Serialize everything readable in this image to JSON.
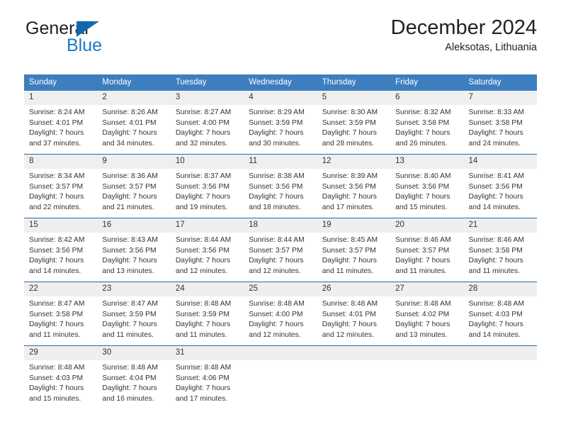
{
  "brand": {
    "name_top": "General",
    "name_bottom": "Blue",
    "triangle_icon": "blue-triangle-icon",
    "color_dark": "#231f20",
    "color_blue": "#1b79c4"
  },
  "header": {
    "title": "December 2024",
    "subtitle": "Aleksotas, Lithuania"
  },
  "colors": {
    "header_row_bg": "#3d7ebf",
    "daynum_bg": "#efefef",
    "week_separator": "#1b6cb0",
    "text": "#333333"
  },
  "weekday_headers": [
    "Sunday",
    "Monday",
    "Tuesday",
    "Wednesday",
    "Thursday",
    "Friday",
    "Saturday"
  ],
  "weeks": [
    [
      {
        "day": "1",
        "sunrise": "Sunrise: 8:24 AM",
        "sunset": "Sunset: 4:01 PM",
        "daylight_line1": "Daylight: 7 hours",
        "daylight_line2": "and 37 minutes."
      },
      {
        "day": "2",
        "sunrise": "Sunrise: 8:26 AM",
        "sunset": "Sunset: 4:01 PM",
        "daylight_line1": "Daylight: 7 hours",
        "daylight_line2": "and 34 minutes."
      },
      {
        "day": "3",
        "sunrise": "Sunrise: 8:27 AM",
        "sunset": "Sunset: 4:00 PM",
        "daylight_line1": "Daylight: 7 hours",
        "daylight_line2": "and 32 minutes."
      },
      {
        "day": "4",
        "sunrise": "Sunrise: 8:29 AM",
        "sunset": "Sunset: 3:59 PM",
        "daylight_line1": "Daylight: 7 hours",
        "daylight_line2": "and 30 minutes."
      },
      {
        "day": "5",
        "sunrise": "Sunrise: 8:30 AM",
        "sunset": "Sunset: 3:59 PM",
        "daylight_line1": "Daylight: 7 hours",
        "daylight_line2": "and 28 minutes."
      },
      {
        "day": "6",
        "sunrise": "Sunrise: 8:32 AM",
        "sunset": "Sunset: 3:58 PM",
        "daylight_line1": "Daylight: 7 hours",
        "daylight_line2": "and 26 minutes."
      },
      {
        "day": "7",
        "sunrise": "Sunrise: 8:33 AM",
        "sunset": "Sunset: 3:58 PM",
        "daylight_line1": "Daylight: 7 hours",
        "daylight_line2": "and 24 minutes."
      }
    ],
    [
      {
        "day": "8",
        "sunrise": "Sunrise: 8:34 AM",
        "sunset": "Sunset: 3:57 PM",
        "daylight_line1": "Daylight: 7 hours",
        "daylight_line2": "and 22 minutes."
      },
      {
        "day": "9",
        "sunrise": "Sunrise: 8:36 AM",
        "sunset": "Sunset: 3:57 PM",
        "daylight_line1": "Daylight: 7 hours",
        "daylight_line2": "and 21 minutes."
      },
      {
        "day": "10",
        "sunrise": "Sunrise: 8:37 AM",
        "sunset": "Sunset: 3:56 PM",
        "daylight_line1": "Daylight: 7 hours",
        "daylight_line2": "and 19 minutes."
      },
      {
        "day": "11",
        "sunrise": "Sunrise: 8:38 AM",
        "sunset": "Sunset: 3:56 PM",
        "daylight_line1": "Daylight: 7 hours",
        "daylight_line2": "and 18 minutes."
      },
      {
        "day": "12",
        "sunrise": "Sunrise: 8:39 AM",
        "sunset": "Sunset: 3:56 PM",
        "daylight_line1": "Daylight: 7 hours",
        "daylight_line2": "and 17 minutes."
      },
      {
        "day": "13",
        "sunrise": "Sunrise: 8:40 AM",
        "sunset": "Sunset: 3:56 PM",
        "daylight_line1": "Daylight: 7 hours",
        "daylight_line2": "and 15 minutes."
      },
      {
        "day": "14",
        "sunrise": "Sunrise: 8:41 AM",
        "sunset": "Sunset: 3:56 PM",
        "daylight_line1": "Daylight: 7 hours",
        "daylight_line2": "and 14 minutes."
      }
    ],
    [
      {
        "day": "15",
        "sunrise": "Sunrise: 8:42 AM",
        "sunset": "Sunset: 3:56 PM",
        "daylight_line1": "Daylight: 7 hours",
        "daylight_line2": "and 14 minutes."
      },
      {
        "day": "16",
        "sunrise": "Sunrise: 8:43 AM",
        "sunset": "Sunset: 3:56 PM",
        "daylight_line1": "Daylight: 7 hours",
        "daylight_line2": "and 13 minutes."
      },
      {
        "day": "17",
        "sunrise": "Sunrise: 8:44 AM",
        "sunset": "Sunset: 3:56 PM",
        "daylight_line1": "Daylight: 7 hours",
        "daylight_line2": "and 12 minutes."
      },
      {
        "day": "18",
        "sunrise": "Sunrise: 8:44 AM",
        "sunset": "Sunset: 3:57 PM",
        "daylight_line1": "Daylight: 7 hours",
        "daylight_line2": "and 12 minutes."
      },
      {
        "day": "19",
        "sunrise": "Sunrise: 8:45 AM",
        "sunset": "Sunset: 3:57 PM",
        "daylight_line1": "Daylight: 7 hours",
        "daylight_line2": "and 11 minutes."
      },
      {
        "day": "20",
        "sunrise": "Sunrise: 8:46 AM",
        "sunset": "Sunset: 3:57 PM",
        "daylight_line1": "Daylight: 7 hours",
        "daylight_line2": "and 11 minutes."
      },
      {
        "day": "21",
        "sunrise": "Sunrise: 8:46 AM",
        "sunset": "Sunset: 3:58 PM",
        "daylight_line1": "Daylight: 7 hours",
        "daylight_line2": "and 11 minutes."
      }
    ],
    [
      {
        "day": "22",
        "sunrise": "Sunrise: 8:47 AM",
        "sunset": "Sunset: 3:58 PM",
        "daylight_line1": "Daylight: 7 hours",
        "daylight_line2": "and 11 minutes."
      },
      {
        "day": "23",
        "sunrise": "Sunrise: 8:47 AM",
        "sunset": "Sunset: 3:59 PM",
        "daylight_line1": "Daylight: 7 hours",
        "daylight_line2": "and 11 minutes."
      },
      {
        "day": "24",
        "sunrise": "Sunrise: 8:48 AM",
        "sunset": "Sunset: 3:59 PM",
        "daylight_line1": "Daylight: 7 hours",
        "daylight_line2": "and 11 minutes."
      },
      {
        "day": "25",
        "sunrise": "Sunrise: 8:48 AM",
        "sunset": "Sunset: 4:00 PM",
        "daylight_line1": "Daylight: 7 hours",
        "daylight_line2": "and 12 minutes."
      },
      {
        "day": "26",
        "sunrise": "Sunrise: 8:48 AM",
        "sunset": "Sunset: 4:01 PM",
        "daylight_line1": "Daylight: 7 hours",
        "daylight_line2": "and 12 minutes."
      },
      {
        "day": "27",
        "sunrise": "Sunrise: 8:48 AM",
        "sunset": "Sunset: 4:02 PM",
        "daylight_line1": "Daylight: 7 hours",
        "daylight_line2": "and 13 minutes."
      },
      {
        "day": "28",
        "sunrise": "Sunrise: 8:48 AM",
        "sunset": "Sunset: 4:03 PM",
        "daylight_line1": "Daylight: 7 hours",
        "daylight_line2": "and 14 minutes."
      }
    ],
    [
      {
        "day": "29",
        "sunrise": "Sunrise: 8:48 AM",
        "sunset": "Sunset: 4:03 PM",
        "daylight_line1": "Daylight: 7 hours",
        "daylight_line2": "and 15 minutes."
      },
      {
        "day": "30",
        "sunrise": "Sunrise: 8:48 AM",
        "sunset": "Sunset: 4:04 PM",
        "daylight_line1": "Daylight: 7 hours",
        "daylight_line2": "and 16 minutes."
      },
      {
        "day": "31",
        "sunrise": "Sunrise: 8:48 AM",
        "sunset": "Sunset: 4:06 PM",
        "daylight_line1": "Daylight: 7 hours",
        "daylight_line2": "and 17 minutes."
      },
      {
        "day": "",
        "sunrise": "",
        "sunset": "",
        "daylight_line1": "",
        "daylight_line2": ""
      },
      {
        "day": "",
        "sunrise": "",
        "sunset": "",
        "daylight_line1": "",
        "daylight_line2": ""
      },
      {
        "day": "",
        "sunrise": "",
        "sunset": "",
        "daylight_line1": "",
        "daylight_line2": ""
      },
      {
        "day": "",
        "sunrise": "",
        "sunset": "",
        "daylight_line1": "",
        "daylight_line2": ""
      }
    ]
  ]
}
